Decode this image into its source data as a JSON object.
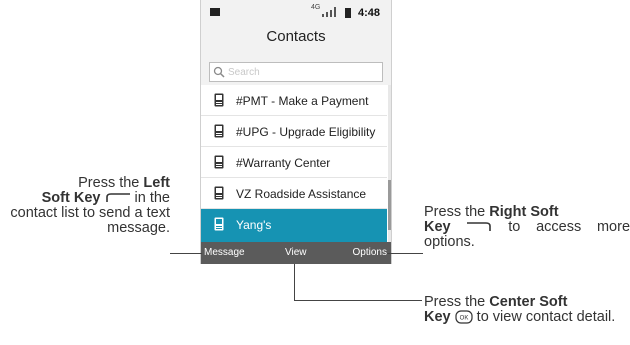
{
  "status_bar": {
    "network": "4G",
    "time": "4:48"
  },
  "app": {
    "title": "Contacts"
  },
  "search": {
    "placeholder": "Search",
    "value": ""
  },
  "contacts": [
    {
      "name": "#PMT - Make a Payment",
      "selected": false
    },
    {
      "name": "#UPG - Upgrade Eligibility",
      "selected": false
    },
    {
      "name": "#Warranty Center",
      "selected": false
    },
    {
      "name": "VZ Roadside Assistance",
      "selected": false
    },
    {
      "name": "Yang's",
      "selected": true
    }
  ],
  "soft_keys": {
    "left": "Message",
    "center": "View",
    "right": "Options"
  },
  "callouts": {
    "left": {
      "pre": "Press the ",
      "bold1": "Left",
      "bold2": "Soft Key",
      "post": " in the contact list to send a text message."
    },
    "right": {
      "pre": "Press the ",
      "bold1": "Right Soft",
      "bold2": "Key",
      "post": " to access more options."
    },
    "center": {
      "pre": "Press the ",
      "bold1": "Center Soft",
      "bold2": "Key",
      "post": " to view contact detail."
    }
  },
  "colors": {
    "selected_row": "#1693b3",
    "soft_key_bar": "#5b5b5b"
  },
  "icons": {
    "ok_key": "OK"
  }
}
